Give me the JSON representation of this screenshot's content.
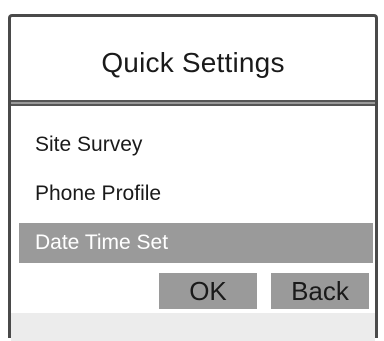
{
  "title": "Quick Settings",
  "menu": {
    "items": [
      {
        "label": "Site Survey",
        "selected": false
      },
      {
        "label": "Phone Profile",
        "selected": false
      },
      {
        "label": "Date Time Set",
        "selected": true
      }
    ]
  },
  "softkeys": {
    "ok_label": "OK",
    "back_label": "Back"
  },
  "colors": {
    "frame": "#4a4a4a",
    "highlight": "#9a9a9a",
    "text": "#1a1a1a",
    "highlight_text": "#ffffff"
  }
}
